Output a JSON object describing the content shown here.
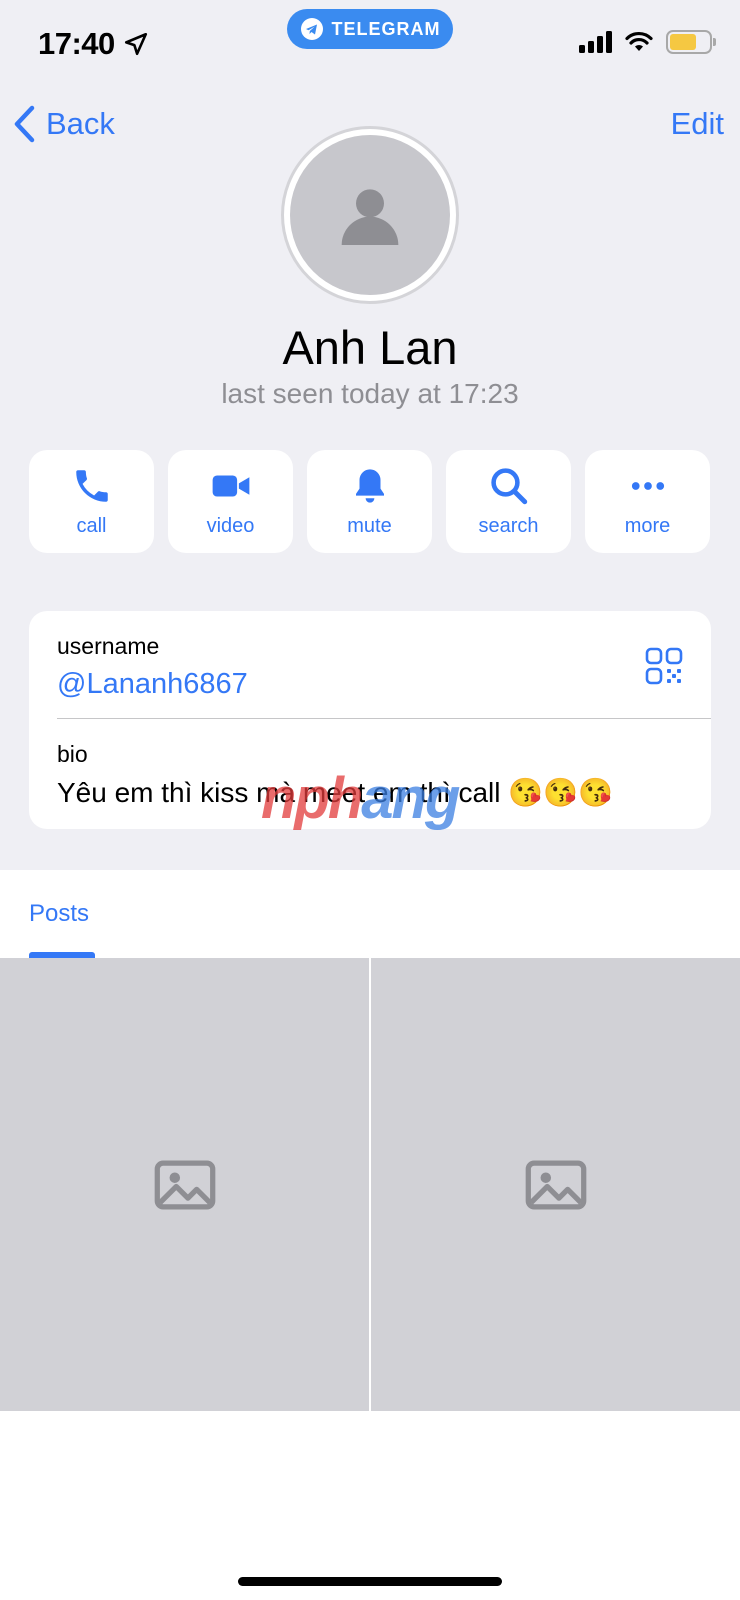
{
  "status_bar": {
    "time": "17:40",
    "app_pill": "TELEGRAM",
    "battery_level": 0.68,
    "battery_color": "#f5c842"
  },
  "nav": {
    "back_label": "Back",
    "edit_label": "Edit"
  },
  "profile": {
    "name": "Anh Lan",
    "last_seen": "last seen today at 17:23",
    "avatar_icon": "photo-placeholder-icon"
  },
  "actions": [
    {
      "label": "call",
      "icon": "phone-icon"
    },
    {
      "label": "video",
      "icon": "video-camera-icon"
    },
    {
      "label": "mute",
      "icon": "bell-icon"
    },
    {
      "label": "search",
      "icon": "search-icon"
    },
    {
      "label": "more",
      "icon": "ellipsis-icon"
    }
  ],
  "info": {
    "username_label": "username",
    "username_value": "@Lananh6867",
    "bio_label": "bio",
    "bio_value": "Yêu em thì kiss mà meet em thì call 😘😘😘"
  },
  "watermark": {
    "part_a": "nph",
    "part_b": "ang"
  },
  "tabs": {
    "posts_label": "Posts"
  },
  "colors": {
    "accent": "#3478f6",
    "background": "#efeff4"
  }
}
